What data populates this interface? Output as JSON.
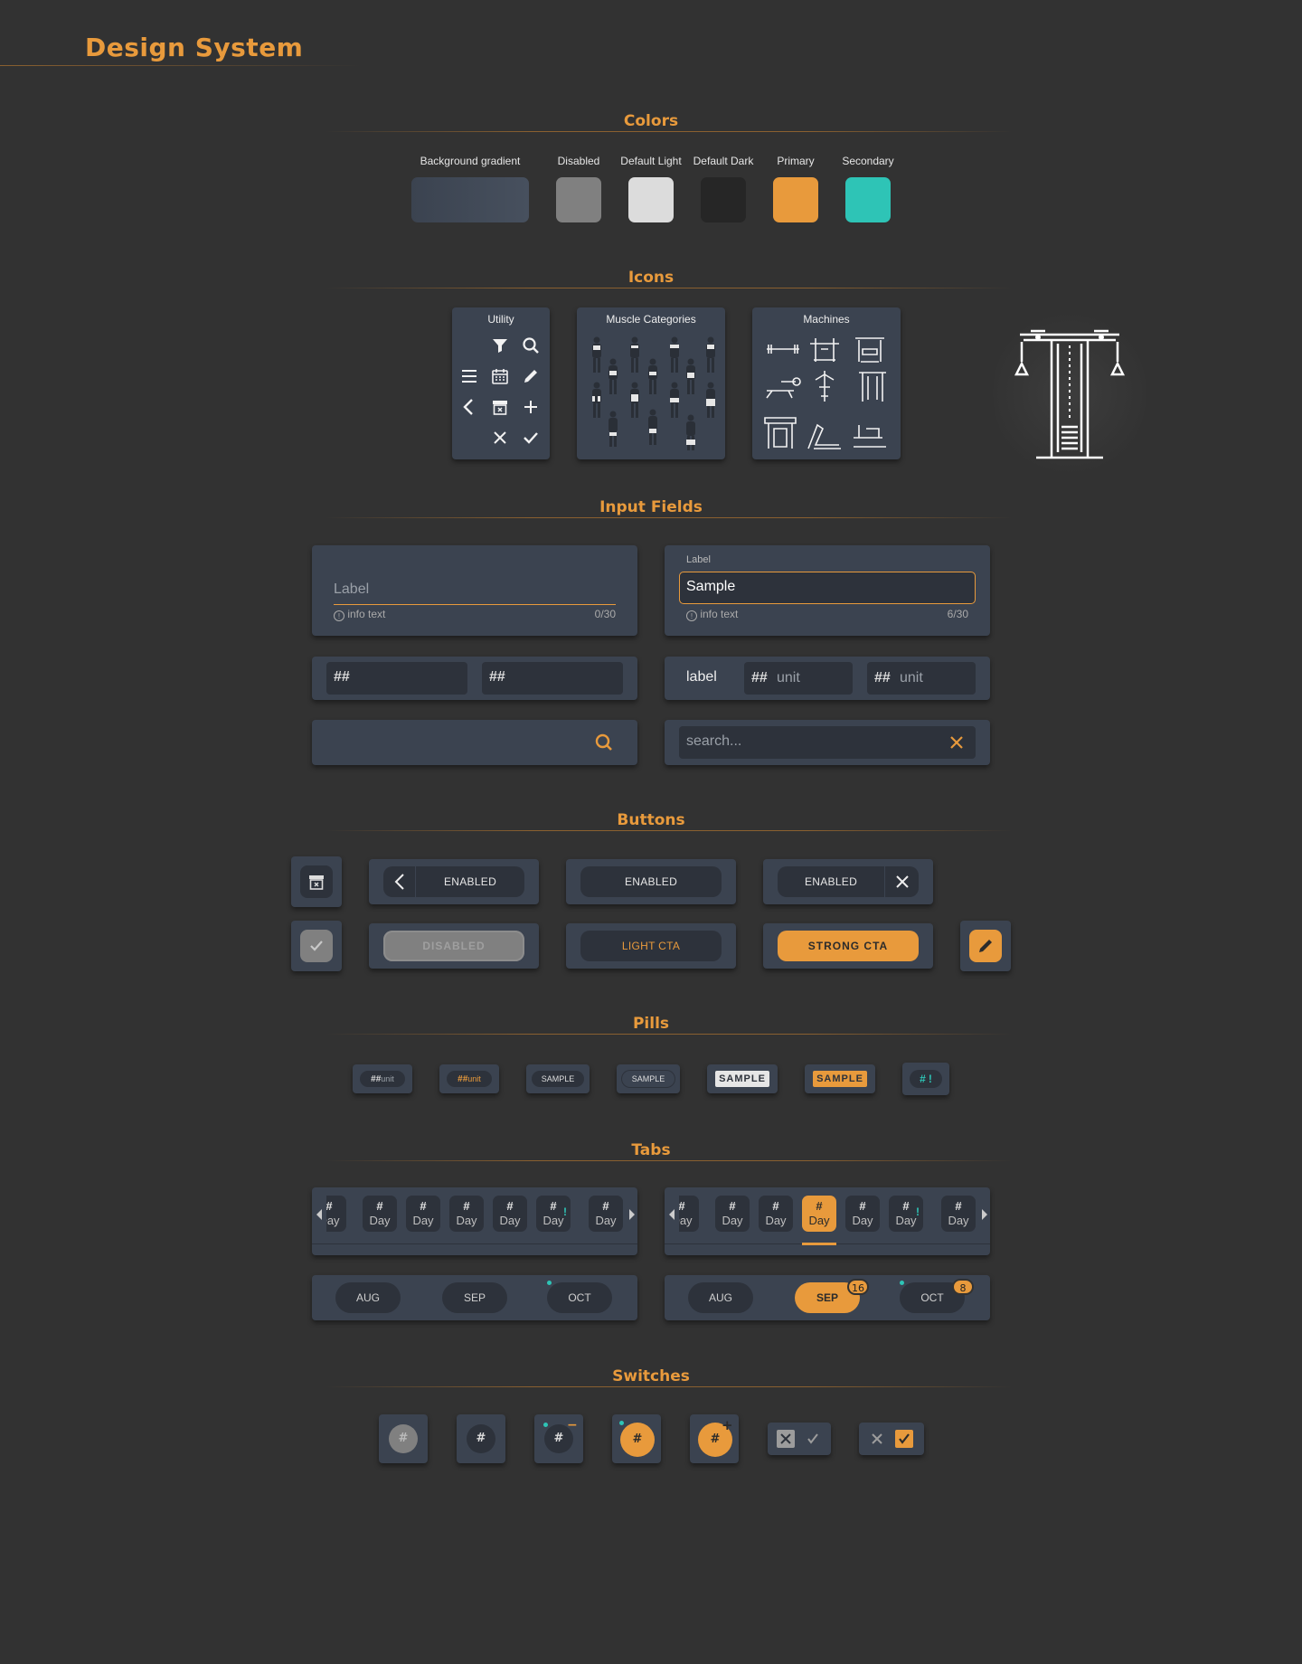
{
  "page": {
    "title": "Design System"
  },
  "colors": {
    "title": "Colors",
    "swatches": [
      {
        "label": "Background gradient",
        "hex": "#3b4350"
      },
      {
        "label": "Disabled",
        "hex": "#808080"
      },
      {
        "label": "Default Light",
        "hex": "#dcdcdc"
      },
      {
        "label": "Default Dark",
        "hex": "#262626"
      },
      {
        "label": "Primary",
        "hex": "#e89a3c"
      },
      {
        "label": "Secondary",
        "hex": "#2ec4b6"
      }
    ]
  },
  "icons": {
    "title": "Icons",
    "utility_title": "Utility",
    "muscle_title": "Muscle Categories",
    "machines_title": "Machines"
  },
  "inputs": {
    "title": "Input Fields",
    "field1": {
      "placeholder": "Label",
      "info": "info text",
      "count": "0/30"
    },
    "field2": {
      "label": "Label",
      "value": "Sample",
      "info": "info text",
      "count": "6/30"
    },
    "num_a": "##",
    "num_b": "##",
    "unit_label": "label",
    "unit_a_num": "##",
    "unit_a_unit": "unit",
    "unit_b_num": "##",
    "unit_b_unit": "unit",
    "search_placeholder": "search..."
  },
  "buttons": {
    "title": "Buttons",
    "enabled": "ENABLED",
    "disabled": "DISABLED",
    "light_cta": "LIGHT CTA",
    "strong_cta": "STRONG CTA"
  },
  "pills": {
    "title": "Pills",
    "num": "##",
    "unit": "unit",
    "sample": "SAMPLE",
    "hash": "#",
    "alert": "!"
  },
  "tabs": {
    "title": "Tabs",
    "num": "#",
    "day": "Day",
    "months": [
      "AUG",
      "SEP",
      "OCT"
    ],
    "badge_sep": "16",
    "badge_oct": "8"
  },
  "switches": {
    "title": "Switches",
    "hash": "#",
    "minus": "−",
    "plus": "+"
  }
}
